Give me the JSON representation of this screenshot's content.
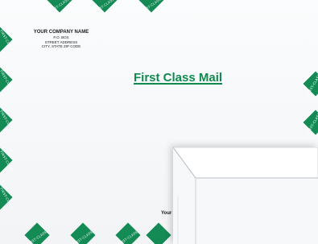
{
  "front_envelope": {
    "return_address": {
      "company": "YOUR COMPANY NAME",
      "box": "P.O. BOX",
      "street": "STREET ADDRESS",
      "city_line": "CITY, STATE ZIP CODE"
    },
    "center_label": "First Class Mail",
    "diamond_text": "FIRST-CLASS",
    "accent_color": "#148a55"
  },
  "back_envelope": {
    "partial_text": "Your"
  }
}
